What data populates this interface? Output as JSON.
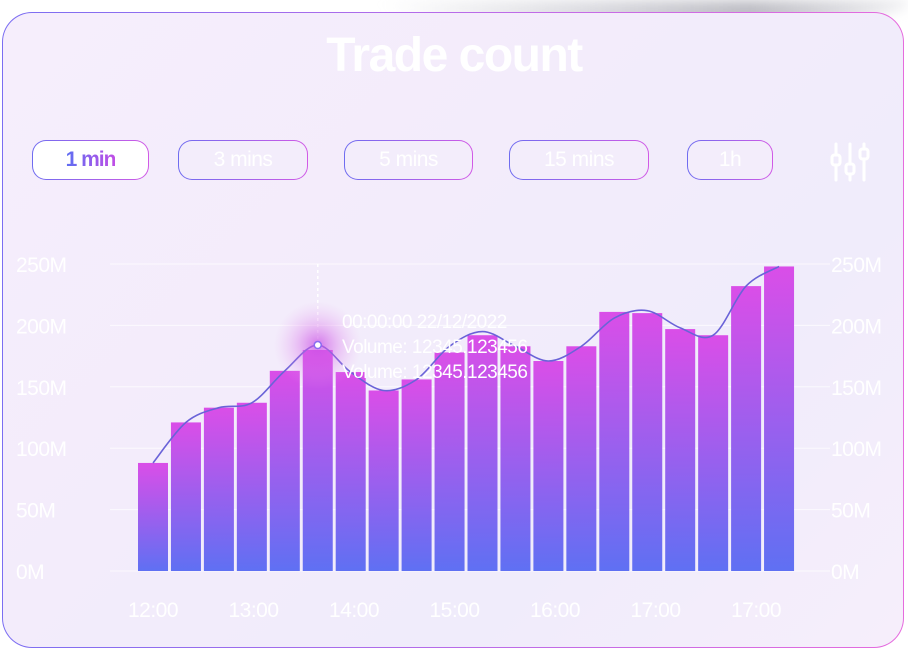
{
  "title": "Trade count",
  "intervals": [
    {
      "label": "1 min",
      "active": true
    },
    {
      "label": "3 mins",
      "active": false
    },
    {
      "label": "5 mins",
      "active": false
    },
    {
      "label": "15 mins",
      "active": false
    },
    {
      "label": "1h",
      "active": false
    }
  ],
  "filter_icon": "sliders-icon",
  "tooltip": {
    "time": "00:00:00 22/12/2022",
    "line1": "Volume: 12345.123456",
    "line2": "Volume: 12345.123456"
  },
  "colors": {
    "bar_top": "#d94ee8",
    "bar_bottom": "#626ef3",
    "line": "#6a63d8",
    "accent": "#8a6cf0"
  },
  "chart_data": {
    "type": "bar",
    "title": "Trade count",
    "x_tick_labels": [
      "12:00",
      "13:00",
      "14:00",
      "15:00",
      "16:00",
      "17:00",
      "17:00"
    ],
    "y_tick_labels": [
      "0M",
      "50M",
      "100M",
      "150M",
      "200M",
      "250M"
    ],
    "ylim": [
      0,
      250
    ],
    "y_unit": "M",
    "values": [
      88,
      121,
      133,
      137,
      163,
      180,
      162,
      147,
      156,
      178,
      192,
      183,
      171,
      183,
      211,
      210,
      197,
      192,
      232,
      248
    ],
    "trend_line": [
      88,
      121,
      133,
      137,
      163,
      184,
      162,
      147,
      156,
      183,
      195,
      183,
      171,
      183,
      206,
      212,
      198,
      192,
      232,
      248
    ],
    "highlighted_index": 5,
    "grid": true,
    "dual_y_axis": true
  }
}
